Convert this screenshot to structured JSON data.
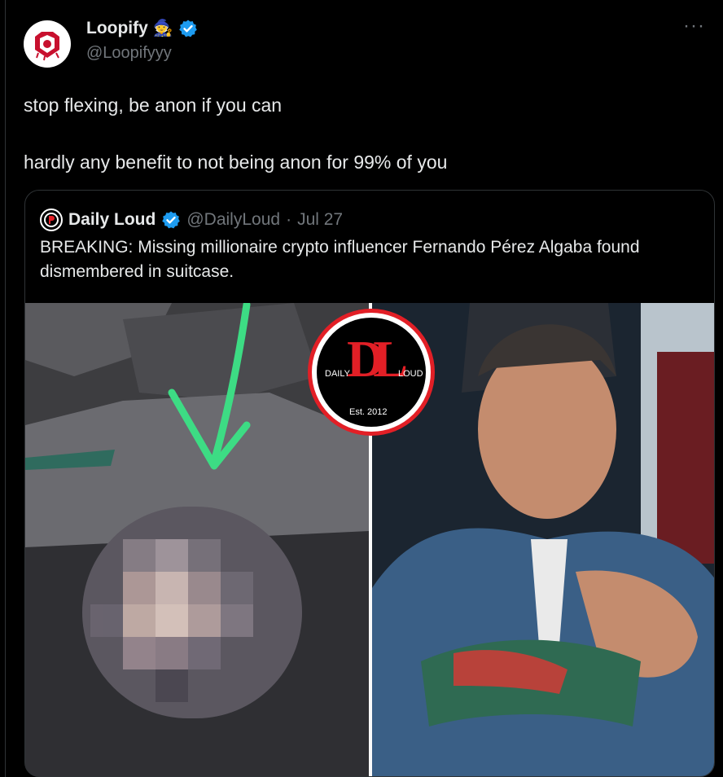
{
  "author": {
    "display_name": "Loopify",
    "name_emoji": "🧙",
    "handle": "@Loopifyyy",
    "verified_icon": "verified-badge-icon"
  },
  "more_label": "···",
  "tweet": {
    "text": "stop flexing, be anon if you can\n\nhardly any benefit to not being anon for 99% of you"
  },
  "quoted": {
    "display_name": "Daily Loud",
    "handle": "@DailyLoud",
    "separator": "·",
    "date": "Jul 27",
    "text": "BREAKING: Missing millionaire crypto influencer Fernando Pérez Algaba found dismembered in suitcase.",
    "media": {
      "logo_letters": "DL",
      "logo_left": "DAILY",
      "logo_right": "LOUD",
      "logo_est": "Est. 2012"
    }
  },
  "colors": {
    "background": "#000000",
    "text": "#e7e9ea",
    "muted": "#71767b",
    "border": "#2f3336",
    "verified": "#1d9bf0",
    "arrow": "#3ddc84",
    "logo_red": "#e21f26"
  }
}
